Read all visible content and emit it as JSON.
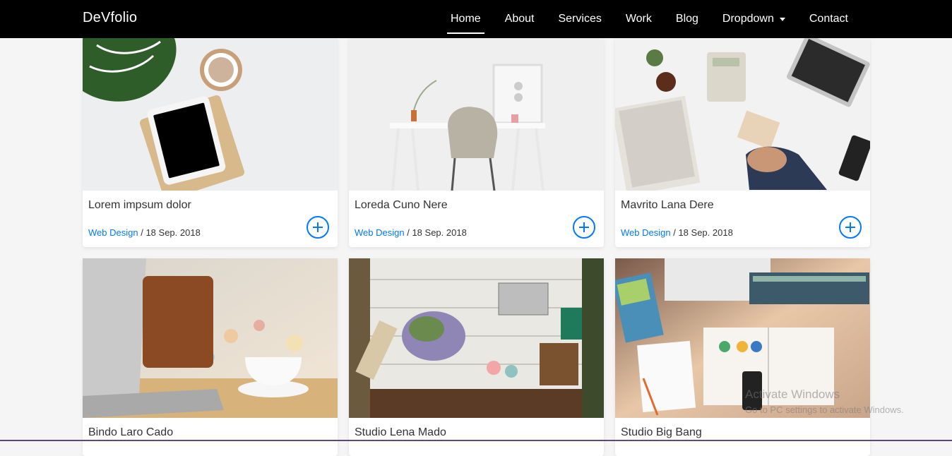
{
  "brand": "DeVfolio",
  "nav": [
    {
      "label": "Home",
      "active": true
    },
    {
      "label": "About"
    },
    {
      "label": "Services"
    },
    {
      "label": "Work"
    },
    {
      "label": "Blog"
    },
    {
      "label": "Dropdown",
      "has_caret": true
    },
    {
      "label": "Contact"
    }
  ],
  "cards": [
    {
      "title": "Lorem impsum dolor",
      "category": "Web Design",
      "separator": "/",
      "date": "18 Sep. 2018",
      "image": "monstera-tablet-coffee-desk"
    },
    {
      "title": "Loreda Cuno Nere",
      "category": "Web Design",
      "separator": "/",
      "date": "18 Sep. 2018",
      "image": "white-desk-chair-plant"
    },
    {
      "title": "Mavrito Lana Dere",
      "category": "Web Design",
      "separator": "/",
      "date": "18 Sep. 2018",
      "image": "business-desk-newspaper-laptop"
    },
    {
      "title": "Bindo Laro Cado",
      "image": "laptop-bag-coffee-cup"
    },
    {
      "title": "Studio Lena Mado",
      "image": "wooden-table-flowers-tools"
    },
    {
      "title": "Studio Big Bang",
      "image": "design-desk-books-catalog"
    }
  ],
  "watermark": {
    "title": "Activate Windows",
    "subtitle": "Go to PC settings to activate Windows."
  },
  "colors": {
    "accent": "#0078ff",
    "navbar": "#000000"
  }
}
